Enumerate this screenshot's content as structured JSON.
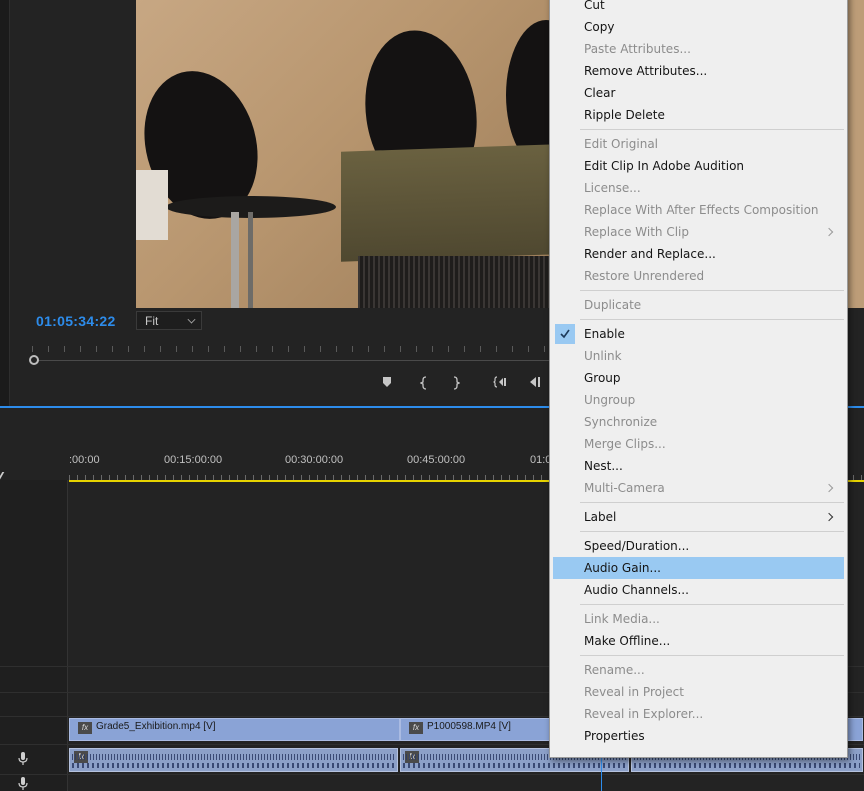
{
  "monitor": {
    "timecode": "01:05:34:22",
    "fit_label": "Fit",
    "transport_icons": [
      "add-marker-icon",
      "mark-in-icon",
      "mark-out-icon",
      "go-to-in-icon",
      "step-back-icon"
    ]
  },
  "timeline": {
    "ruler_labels": [
      ":00:00",
      "00:15:00:00",
      "00:30:00:00",
      "00:45:00:00",
      "01:0"
    ],
    "video_clips": [
      {
        "name": "Grade5_Exhibition.mp4 [V]"
      },
      {
        "name": "P1000598.MP4 [V]"
      },
      {
        "name": ""
      }
    ],
    "audio_clips": 3
  },
  "context_menu": {
    "items": [
      {
        "label": "Cut",
        "enabled": true
      },
      {
        "label": "Copy",
        "enabled": true
      },
      {
        "label": "Paste Attributes...",
        "enabled": false
      },
      {
        "label": "Remove Attributes...",
        "enabled": true
      },
      {
        "label": "Clear",
        "enabled": true
      },
      {
        "label": "Ripple Delete",
        "enabled": true
      },
      {
        "label": "Edit Original",
        "enabled": false
      },
      {
        "label": "Edit Clip In Adobe Audition",
        "enabled": true
      },
      {
        "label": "License...",
        "enabled": false
      },
      {
        "label": "Replace With After Effects Composition",
        "enabled": false
      },
      {
        "label": "Replace With Clip",
        "enabled": false,
        "submenu": true
      },
      {
        "label": "Render and Replace...",
        "enabled": true
      },
      {
        "label": "Restore Unrendered",
        "enabled": false
      },
      {
        "label": "Duplicate",
        "enabled": false
      },
      {
        "label": "Enable",
        "enabled": true,
        "checked": true
      },
      {
        "label": "Unlink",
        "enabled": false
      },
      {
        "label": "Group",
        "enabled": true
      },
      {
        "label": "Ungroup",
        "enabled": false
      },
      {
        "label": "Synchronize",
        "enabled": false
      },
      {
        "label": "Merge Clips...",
        "enabled": false
      },
      {
        "label": "Nest...",
        "enabled": true
      },
      {
        "label": "Multi-Camera",
        "enabled": false,
        "submenu": true
      },
      {
        "label": "Label",
        "enabled": true,
        "submenu": true
      },
      {
        "label": "Speed/Duration...",
        "enabled": true
      },
      {
        "label": "Audio Gain...",
        "enabled": true,
        "highlighted": true
      },
      {
        "label": "Audio Channels...",
        "enabled": true
      },
      {
        "label": "Link Media...",
        "enabled": false
      },
      {
        "label": "Make Offline...",
        "enabled": true
      },
      {
        "label": "Rename...",
        "enabled": false
      },
      {
        "label": "Reveal in Project",
        "enabled": false
      },
      {
        "label": "Reveal in Explorer...",
        "enabled": false
      },
      {
        "label": "Properties",
        "enabled": true
      }
    ]
  },
  "colors": {
    "accent_blue": "#2d8ceb",
    "menu_highlight": "#99c9f2",
    "work_area_yellow": "#e6d300",
    "video_clip": "#8aa3d6",
    "audio_clip": "#8ca0c8"
  }
}
